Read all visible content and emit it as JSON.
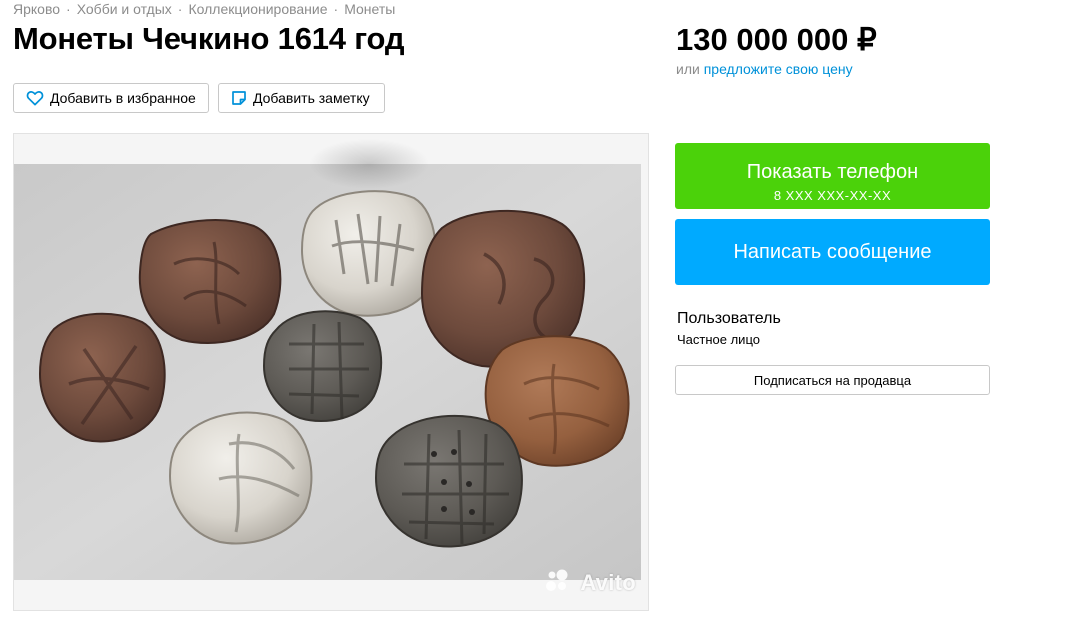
{
  "breadcrumb": [
    "Ярково",
    "Хобби и отдых",
    "Коллекционирование",
    "Монеты"
  ],
  "listing": {
    "title": "Монеты Чечкино 1614 год",
    "price": "130 000 000 ₽",
    "price_alt_prefix": "или",
    "price_alt_link": "предложите свою цену"
  },
  "actions": {
    "favorite": "Добавить в избранное",
    "note": "Добавить заметку"
  },
  "photo": {
    "watermark": "Avito"
  },
  "contact": {
    "phone_label": "Показать телефон",
    "phone_masked": "8 XXX XXX-XX-XX",
    "message_label": "Написать сообщение",
    "colors": {
      "phone_button": "#4bd20a",
      "message_button": "#00aaff",
      "link": "#0091d9"
    }
  },
  "seller": {
    "name": "Пользователь",
    "type": "Частное лицо",
    "subscribe_label": "Подписаться на продавца"
  }
}
